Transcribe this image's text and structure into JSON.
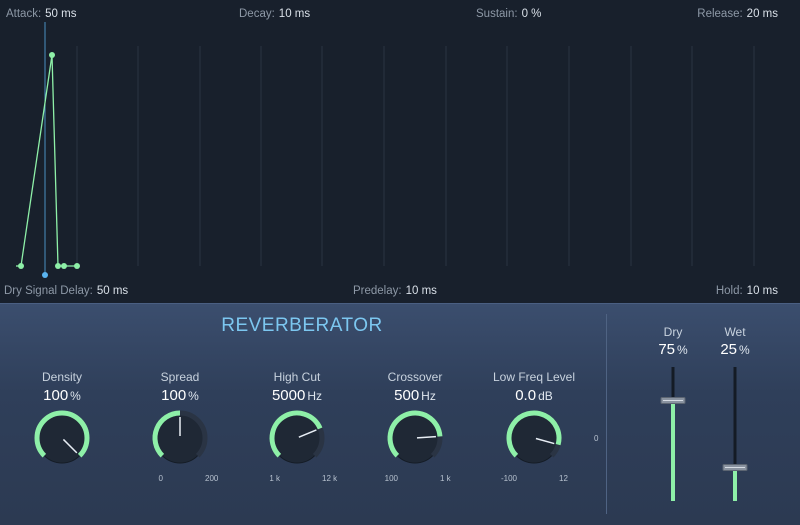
{
  "envelope": {
    "attack": {
      "label": "Attack:",
      "value": "50 ms"
    },
    "decay": {
      "label": "Decay:",
      "value": "10 ms"
    },
    "sustain": {
      "label": "Sustain:",
      "value": "0 %"
    },
    "release": {
      "label": "Release:",
      "value": "20 ms"
    },
    "dry_signal_delay": {
      "label": "Dry Signal Delay:",
      "value": "50 ms"
    },
    "predelay": {
      "label": "Predelay:",
      "value": "10 ms"
    },
    "hold": {
      "label": "Hold:",
      "value": "10 ms"
    }
  },
  "plugin": {
    "title": "REVERBERATOR",
    "colors": {
      "accent": "#8ef0a8",
      "title": "#7cc7f0",
      "handle_blue": "#5ab4f0"
    }
  },
  "knobs": [
    {
      "label": "Density",
      "value": "100",
      "unit": "%",
      "fraction": 1.0,
      "ticks": []
    },
    {
      "label": "Spread",
      "value": "100",
      "unit": "%",
      "fraction": 0.5,
      "ticks": [
        "0",
        "200"
      ]
    },
    {
      "label": "High Cut",
      "value": "5000",
      "unit": "Hz",
      "fraction": 0.75,
      "ticks": [
        "1 k",
        "12 k"
      ]
    },
    {
      "label": "Crossover",
      "value": "500",
      "unit": "Hz",
      "fraction": 0.82,
      "ticks": [
        "100",
        "1 k"
      ]
    },
    {
      "label": "Low Freq Level",
      "value": "0.0",
      "unit": "dB",
      "fraction": 0.89,
      "ticks": [
        "-100",
        "12",
        "0"
      ]
    }
  ],
  "faders": [
    {
      "label": "Dry",
      "value": "75",
      "unit": "%",
      "fraction": 0.75
    },
    {
      "label": "Wet",
      "value": "25",
      "unit": "%",
      "fraction": 0.25
    }
  ]
}
